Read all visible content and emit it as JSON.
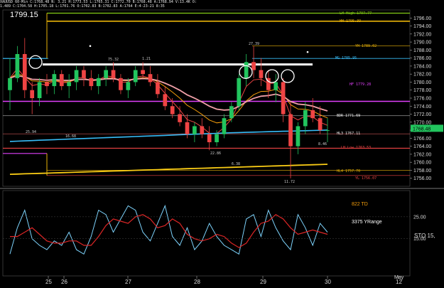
{
  "header": {
    "line1": "XAUUSD 60-Min  C:1768.48  N: 3.21  H:1773.53  L:1765.31  C:1772.70  B:1768.48  A:1768.94  V:13.4K  O:",
    "line2": "1.489  C:1704.58  H:1705.18  L:1701.76  O:1702.83  B:1702.83  A:1764  E:4-23-21 8:35"
  },
  "big_price": "1799.15",
  "colors": {
    "background": "#000000",
    "panel_border": "#ffffff",
    "candle_up": "#22c55e",
    "candle_down": "#ef4444",
    "ma_blue": "#38bdf8",
    "ma_yellow": "#facc15",
    "ma_pink": "#f0a0a8",
    "ma_orange": "#f59e0b",
    "level_magenta": "#e040fb",
    "level_red": "#ef4444",
    "level_green": "#84cc16",
    "level_gold": "#eab308",
    "osc_cyan": "#7dd3fc",
    "osc_red": "#dc2626",
    "hline_white": "#ffffff",
    "current_price_bg": "#22c55e"
  },
  "chart_data": {
    "type": "candlestick",
    "symbol": "XAUUSD",
    "timeframe": "60-Min",
    "ylim": [
      1754,
      1798
    ],
    "y_ticks": [
      "1796.00",
      "1794.00",
      "1792.00",
      "1790.00",
      "1788.00",
      "1786.00",
      "1784.00",
      "1782.00",
      "1780.00",
      "1778.00",
      "1776.00",
      "1774.00",
      "1772.00",
      "1770.00",
      "1768.00",
      "1766.00",
      "1764.00",
      "1762.00",
      "1760.00",
      "1758.00",
      "1756.00"
    ],
    "current_price": "1768.48",
    "x_ticks": [
      "25",
      "26",
      "27",
      "28",
      "29",
      "30",
      "12"
    ],
    "x_top_label": "May",
    "candles": [
      [
        1778,
        1786,
        1773,
        1781
      ],
      [
        1781,
        1789,
        1780,
        1787
      ],
      [
        1787,
        1791,
        1776,
        1778
      ],
      [
        1778,
        1780,
        1772,
        1776
      ],
      [
        1776,
        1781,
        1774,
        1780
      ],
      [
        1780,
        1782,
        1777,
        1779
      ],
      [
        1779,
        1783,
        1777,
        1782
      ],
      [
        1782,
        1783,
        1778,
        1779
      ],
      [
        1779,
        1782,
        1776,
        1780
      ],
      [
        1780,
        1784,
        1778,
        1783
      ],
      [
        1783,
        1784,
        1779,
        1781
      ],
      [
        1781,
        1783,
        1778,
        1779
      ],
      [
        1779,
        1782,
        1777,
        1781
      ],
      [
        1781,
        1784,
        1779,
        1783
      ],
      [
        1783,
        1785,
        1780,
        1781
      ],
      [
        1781,
        1782,
        1777,
        1778
      ],
      [
        1778,
        1781,
        1776,
        1780
      ],
      [
        1780,
        1784,
        1779,
        1783
      ],
      [
        1783,
        1785,
        1781,
        1782
      ],
      [
        1782,
        1784,
        1779,
        1780
      ],
      [
        1780,
        1782,
        1776,
        1777
      ],
      [
        1777,
        1779,
        1773,
        1774
      ],
      [
        1774,
        1776,
        1771,
        1772
      ],
      [
        1772,
        1774,
        1769,
        1770
      ],
      [
        1770,
        1772,
        1766,
        1767
      ],
      [
        1767,
        1770,
        1765,
        1769
      ],
      [
        1769,
        1771,
        1766,
        1767
      ],
      [
        1767,
        1769,
        1763,
        1765
      ],
      [
        1765,
        1768,
        1764,
        1767
      ],
      [
        1767,
        1772,
        1766,
        1771
      ],
      [
        1771,
        1775,
        1770,
        1774
      ],
      [
        1774,
        1782,
        1773,
        1781
      ],
      [
        1781,
        1787,
        1779,
        1785
      ],
      [
        1785,
        1789,
        1781,
        1783
      ],
      [
        1783,
        1786,
        1779,
        1781
      ],
      [
        1781,
        1783,
        1776,
        1778
      ],
      [
        1778,
        1782,
        1775,
        1780
      ],
      [
        1780,
        1781,
        1770,
        1772
      ],
      [
        1772,
        1775,
        1756,
        1764
      ],
      [
        1764,
        1770,
        1762,
        1769
      ],
      [
        1769,
        1775,
        1767,
        1773
      ],
      [
        1773,
        1776,
        1770,
        1771
      ],
      [
        1771,
        1774,
        1767,
        1768
      ],
      [
        1768,
        1771,
        1765,
        1768
      ]
    ],
    "level_labels": [
      {
        "text": "LH High 1797.77",
        "color": "#84cc16"
      },
      {
        "text": "HH 1795.39",
        "color": "#eab308"
      },
      {
        "text": "YH 1789.02",
        "color": "#eab308"
      },
      {
        "text": "MG 1785.95",
        "color": "#38bdf8"
      },
      {
        "text": "HF 1779.28",
        "color": "#e040fb"
      },
      {
        "text": "BDR 1771.69",
        "color": "#f0f0f0"
      },
      {
        "text": "HL3 1767.11",
        "color": "#f0f0f0"
      },
      {
        "text": "LH Low 1763.53",
        "color": "#ef4444"
      },
      {
        "text": "HL4 1757.70",
        "color": "#eab308"
      },
      {
        "text": "YL 1756.07",
        "color": "#ef4444"
      }
    ],
    "small_annotations": [
      "27.39",
      "75.32",
      "1.21",
      "25.94",
      "16.68",
      "22.86",
      "11.72",
      "8.46",
      "6.38"
    ],
    "oscillator": {
      "label": "STO",
      "value_label": "15,",
      "y_ticks": [
        "25.00",
        "15.00"
      ],
      "text_td": "822 TD",
      "text_range": "3375 YRange",
      "k_values": [
        8,
        20,
        28,
        15,
        12,
        10,
        14,
        12,
        18,
        10,
        8,
        16,
        28,
        26,
        18,
        24,
        30,
        28,
        18,
        14,
        22,
        30,
        16,
        12,
        20,
        10,
        14,
        22,
        16,
        12,
        10,
        8,
        24,
        26,
        16,
        28,
        20,
        14,
        10,
        26,
        20,
        12,
        22,
        18
      ],
      "d_values": [
        16,
        16,
        18,
        20,
        17,
        14,
        13,
        13,
        14,
        14,
        12,
        12,
        16,
        21,
        24,
        23,
        22,
        25,
        26,
        24,
        20,
        21,
        24,
        22,
        17,
        15,
        14,
        15,
        17,
        16,
        13,
        11,
        13,
        18,
        22,
        23,
        26,
        24,
        20,
        17,
        18,
        19,
        18,
        17
      ]
    }
  }
}
